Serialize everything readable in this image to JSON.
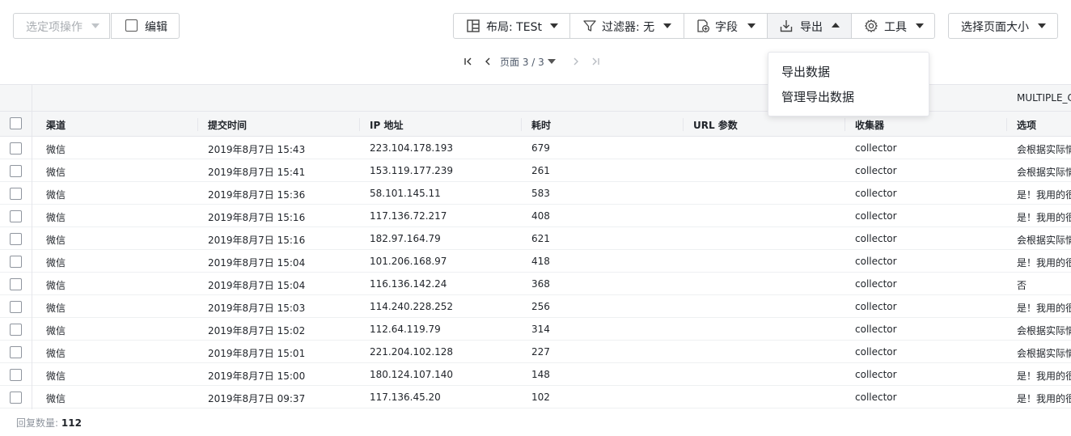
{
  "toolbar": {
    "bulk_actions_label": "选定项操作",
    "edit_label": "编辑",
    "layout_label": "布局: TESt",
    "filter_label": "过滤器: 无",
    "fields_label": "字段",
    "export_label": "导出",
    "tools_label": "工具",
    "page_size_label": "选择页面大小"
  },
  "pagination": {
    "label": "页面 3 / 3"
  },
  "export_menu": {
    "items": [
      "导出数据",
      "管理导出数据"
    ]
  },
  "table": {
    "group_label": "MULTIPLE_C",
    "columns": [
      "渠道",
      "提交时间",
      "IP 地址",
      "耗时",
      "URL 参数",
      "收集器",
      "选项"
    ],
    "rows": [
      [
        "微信",
        "2019年8月7日 15:43",
        "223.104.178.193",
        "679",
        "",
        "collector",
        "会根据实际情"
      ],
      [
        "微信",
        "2019年8月7日 15:41",
        "153.119.177.239",
        "261",
        "",
        "collector",
        "会根据实际情"
      ],
      [
        "微信",
        "2019年8月7日 15:36",
        "58.101.145.11",
        "583",
        "",
        "collector",
        "是！我用的很"
      ],
      [
        "微信",
        "2019年8月7日 15:16",
        "117.136.72.217",
        "408",
        "",
        "collector",
        "是！我用的很"
      ],
      [
        "微信",
        "2019年8月7日 15:16",
        "182.97.164.79",
        "621",
        "",
        "collector",
        "会根据实际情"
      ],
      [
        "微信",
        "2019年8月7日 15:04",
        "101.206.168.97",
        "418",
        "",
        "collector",
        "是！我用的很"
      ],
      [
        "微信",
        "2019年8月7日 15:04",
        "116.136.142.24",
        "368",
        "",
        "collector",
        "否"
      ],
      [
        "微信",
        "2019年8月7日 15:03",
        "114.240.228.252",
        "256",
        "",
        "collector",
        "是！我用的很"
      ],
      [
        "微信",
        "2019年8月7日 15:02",
        "112.64.119.79",
        "314",
        "",
        "collector",
        "会根据实际情"
      ],
      [
        "微信",
        "2019年8月7日 15:01",
        "221.204.102.128",
        "227",
        "",
        "collector",
        "会根据实际情"
      ],
      [
        "微信",
        "2019年8月7日 15:00",
        "180.124.107.140",
        "148",
        "",
        "collector",
        "是！我用的很"
      ],
      [
        "微信",
        "2019年8月7日 09:37",
        "117.136.45.20",
        "102",
        "",
        "collector",
        "是！我用的很"
      ]
    ]
  },
  "footer": {
    "count_label": "回复数量:",
    "count_value": "112"
  }
}
